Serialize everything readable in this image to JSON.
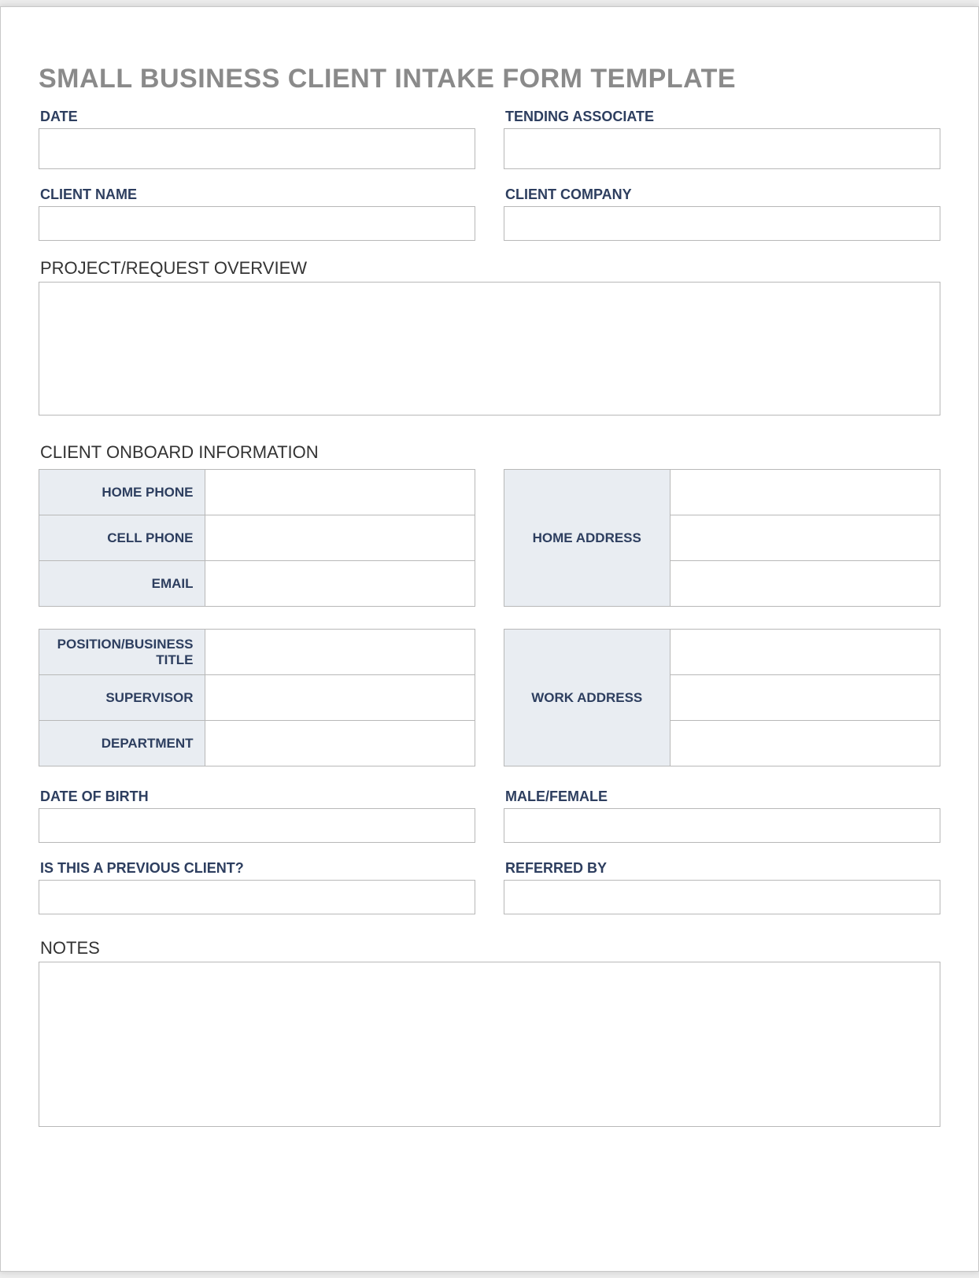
{
  "title": "SMALL BUSINESS CLIENT INTAKE FORM TEMPLATE",
  "top": {
    "date_label": "DATE",
    "associate_label": "TENDING ASSOCIATE",
    "client_name_label": "CLIENT NAME",
    "client_company_label": "CLIENT COMPANY"
  },
  "overview": {
    "header": "PROJECT/REQUEST OVERVIEW"
  },
  "onboard": {
    "header": "CLIENT ONBOARD INFORMATION",
    "block1_left": {
      "home_phone": "HOME PHONE",
      "cell_phone": "CELL PHONE",
      "email": "EMAIL"
    },
    "block1_right_label": "HOME ADDRESS",
    "block2_left": {
      "position_line1": "POSITION/BUSINESS",
      "position_line2": "TITLE",
      "supervisor": "SUPERVISOR",
      "department": "DEPARTMENT"
    },
    "block2_right_label": "WORK ADDRESS"
  },
  "extra": {
    "dob_label": "DATE OF BIRTH",
    "gender_label": "MALE/FEMALE",
    "previous_client_label": "IS THIS A PREVIOUS CLIENT?",
    "referred_by_label": "REFERRED BY"
  },
  "notes": {
    "header": "NOTES"
  }
}
